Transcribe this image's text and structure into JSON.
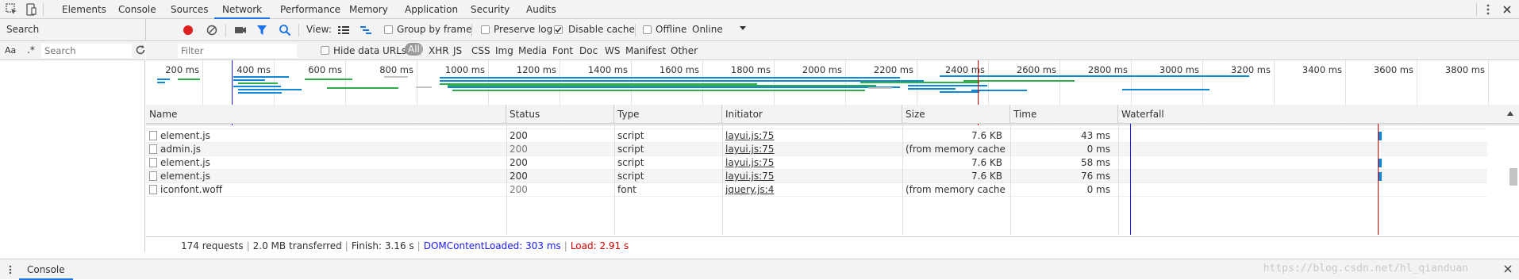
{
  "tabs": [
    "Elements",
    "Console",
    "Sources",
    "Network",
    "Performance",
    "Memory",
    "Application",
    "Security",
    "Audits"
  ],
  "active_tab": "Network",
  "toolbar": {
    "view_label": "View:",
    "group_by_frame": "Group by frame",
    "preserve_log": "Preserve log",
    "disable_cache": "Disable cache",
    "offline": "Offline",
    "throttle": "Online"
  },
  "search_panel": {
    "title": "Search",
    "placeholder": "Search",
    "match_case": "Aa",
    "regex": ".*"
  },
  "filter": {
    "placeholder": "Filter",
    "hide_data_urls": "Hide data URLs",
    "types": [
      "All",
      "XHR",
      "JS",
      "CSS",
      "Img",
      "Media",
      "Font",
      "Doc",
      "WS",
      "Manifest",
      "Other"
    ]
  },
  "overview": {
    "ticks": [
      "200 ms",
      "400 ms",
      "600 ms",
      "800 ms",
      "1000 ms",
      "1200 ms",
      "1400 ms",
      "1600 ms",
      "1800 ms",
      "2000 ms",
      "2200 ms",
      "2400 ms",
      "2600 ms",
      "2800 ms",
      "3000 ms",
      "3200 ms",
      "3400 ms",
      "3600 ms",
      "3800 ms"
    ]
  },
  "table": {
    "columns": [
      "Name",
      "Status",
      "Type",
      "Initiator",
      "Size",
      "Time",
      "Waterfall"
    ],
    "rows": [
      {
        "name": "element.js",
        "status": "200",
        "type": "script",
        "initiator": "layui.js:75",
        "size": "7.6 KB",
        "time": "43 ms"
      },
      {
        "name": "admin.js",
        "status": "200",
        "type": "script",
        "initiator": "layui.js:75",
        "size": "(from memory cache)",
        "time": "0 ms"
      },
      {
        "name": "element.js",
        "status": "200",
        "type": "script",
        "initiator": "layui.js:75",
        "size": "7.6 KB",
        "time": "58 ms"
      },
      {
        "name": "element.js",
        "status": "200",
        "type": "script",
        "initiator": "layui.js:75",
        "size": "7.6 KB",
        "time": "76 ms"
      },
      {
        "name": "iconfont.woff",
        "status": "200",
        "type": "font",
        "initiator": "jquery.js:4",
        "size": "(from memory cache)",
        "time": "0 ms"
      }
    ]
  },
  "status": {
    "requests": "174 requests",
    "transferred": "2.0 MB transferred",
    "finish": "Finish: 3.16 s",
    "dom_content_loaded": "DOMContentLoaded: 303 ms",
    "load": "Load: 2.91 s"
  },
  "drawer": {
    "console_tab": "Console"
  },
  "watermark": "https://blog.csdn.net/hl_qianduan",
  "colors": {
    "dcl": "#1a1aff",
    "load": "#d40000",
    "accent": "#1a73e8",
    "record": "#e02020"
  }
}
